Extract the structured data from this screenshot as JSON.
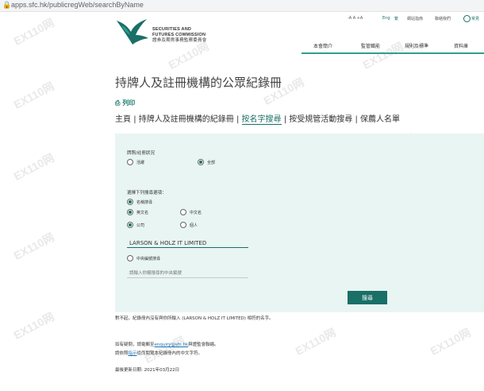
{
  "browser": {
    "url": "apps.sfc.hk/publicregWeb/searchByName"
  },
  "watermark": "EX110网",
  "header": {
    "logo_text": [
      "SECURITIES AND",
      "FUTURES COMMISSION",
      "證券及期貨事務監察委員會"
    ],
    "font_size": "-A  A  +A",
    "lang": "Eng",
    "lang2": "繁",
    "utility_links": [
      "網站指南",
      "聯絡我們"
    ],
    "help": "常見",
    "nav": [
      "本會簡介",
      "監管職能",
      "規則及標準",
      "資料庫"
    ]
  },
  "page": {
    "title": "持牌人及註冊機構的公眾紀錄冊",
    "print": "列印",
    "breadcrumb": {
      "home": "主頁",
      "register": "持牌人及註冊機構的紀錄冊",
      "by_name": "按名字搜尋",
      "disciplinary": "按受規管活動搜尋",
      "sponsors": "保薦人名單",
      "sep": "|"
    }
  },
  "form": {
    "status_label": "牌照/註冊狀況",
    "status_options": [
      "活躍",
      "全部"
    ],
    "criteria_label": "選擇下列搜尋選項：",
    "name_search": "名稱搜尋",
    "lang_options": [
      "英文名",
      "中文名"
    ],
    "type_options": [
      "公司",
      "個人"
    ],
    "name_value": "LARSON & HOLZ IT LIMITED",
    "ce_search": "中央編號搜尋",
    "ce_placeholder": "請輸入你擬搜尋的中央編號",
    "search_button": "搜尋"
  },
  "result_note": "對不起，紀錄冊內沒有與你所輸入 (LARSON & HOLZ IT LIMITED) 相符的名字。",
  "footer": {
    "contact_pre": "如有疑問，請電郵至",
    "contact_email": "enquiry@sfc.hk",
    "contact_post": "與證監會聯絡。",
    "glossary_pre": "請依照",
    "glossary_link": "指示",
    "glossary_post": "從而閱覽本紀錄冊內的中文字符。",
    "updated": "最後更新日期: 2021年03月22日"
  },
  "colors": {
    "accent": "#1a6f67",
    "panel": "#e8f5f3",
    "nav_line": "#2e9e8f"
  }
}
